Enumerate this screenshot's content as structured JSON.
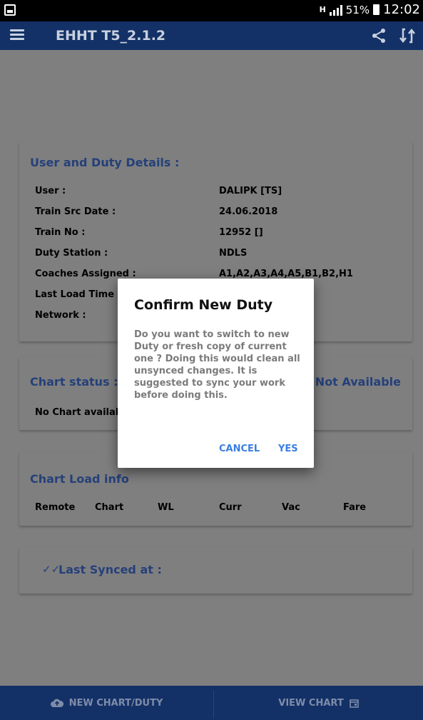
{
  "statusbar": {
    "network": "H",
    "battery": "51%",
    "time": "12:02"
  },
  "appbar": {
    "title": "EHHT T5_2.1.2"
  },
  "details": {
    "title": "User and Duty Details :",
    "rows": [
      {
        "label": "User :",
        "value": "DALIPK [TS]"
      },
      {
        "label": "Train Src Date :",
        "value": "24.06.2018"
      },
      {
        "label": "Train No :",
        "value": "12952 []"
      },
      {
        "label": "Duty Station :",
        "value": "NDLS"
      },
      {
        "label": "Coaches Assigned :",
        "value": "A1,A2,A3,A4,A5,B1,B2,H1"
      },
      {
        "label": "Last Load Time :",
        "value": ""
      },
      {
        "label": "Network :",
        "value": ""
      }
    ]
  },
  "chart_status": {
    "title": "Chart status :",
    "status": "Not Available",
    "message": "No Chart available"
  },
  "chart_load": {
    "title": "Chart Load info",
    "columns": [
      "Remote",
      "Chart",
      "WL",
      "Curr",
      "Vac",
      "Fare"
    ]
  },
  "sync": {
    "label": "Last Synced at :"
  },
  "bottom": {
    "new_chart": "NEW CHART/DUTY",
    "view_chart": "VIEW CHART"
  },
  "dialog": {
    "title": "Confirm New Duty",
    "message": "Do you want to switch to new Duty or fresh copy of current one ? Doing this would clean all unsynced changes. It is suggested to sync your work before doing this.",
    "cancel": "CANCEL",
    "yes": "YES"
  },
  "colors": {
    "app_bar": "#133167",
    "accent": "#3a7ee0",
    "card_title": "#25407a",
    "overlay": "#7f7f7f"
  }
}
